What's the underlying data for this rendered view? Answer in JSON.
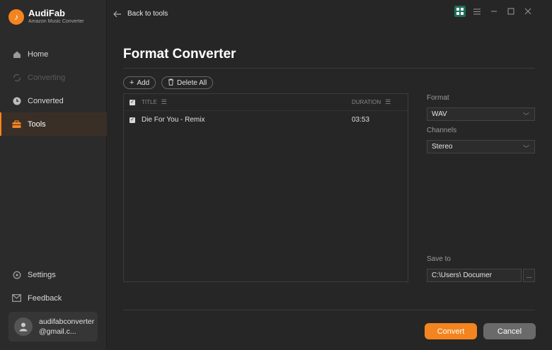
{
  "app": {
    "name": "AudiFab",
    "subtitle": "Amazon Music Converter",
    "accent": "#f4841f"
  },
  "sidebar": {
    "items": [
      {
        "label": "Home",
        "icon": "home-icon",
        "state": "normal"
      },
      {
        "label": "Converting",
        "icon": "sync-icon",
        "state": "disabled"
      },
      {
        "label": "Converted",
        "icon": "clock-icon",
        "state": "normal"
      },
      {
        "label": "Tools",
        "icon": "toolbox-icon",
        "state": "active"
      }
    ],
    "bottom_items": [
      {
        "label": "Settings",
        "icon": "gear-icon"
      },
      {
        "label": "Feedback",
        "icon": "mail-icon"
      }
    ],
    "account": {
      "email": "audifabconverter@gmail.c..."
    }
  },
  "topbar": {
    "back_label": "Back to tools"
  },
  "main": {
    "title": "Format Converter",
    "add_label": "Add",
    "delete_all_label": "Delete All",
    "table": {
      "columns": [
        "TITLE",
        "DURATION"
      ],
      "rows": [
        {
          "title": "Die For You - Remix",
          "duration": "03:53",
          "checked": true
        }
      ]
    }
  },
  "settings_panel": {
    "format_label": "Format",
    "format_value": "WAV",
    "channels_label": "Channels",
    "channels_value": "Stereo",
    "save_to_label": "Save to",
    "save_to_value": "C:\\Users\\        Documer",
    "browse_label": "..."
  },
  "footer": {
    "convert_label": "Convert",
    "cancel_label": "Cancel"
  }
}
